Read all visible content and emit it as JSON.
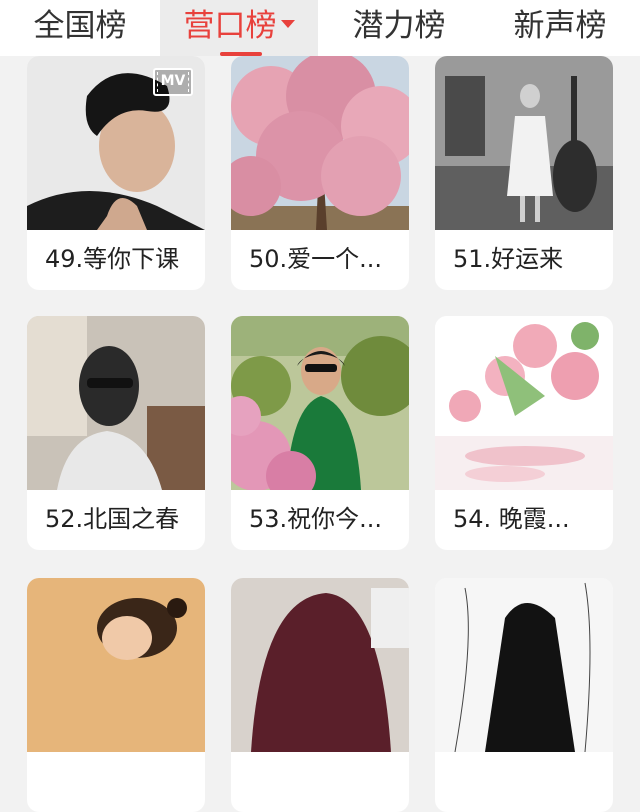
{
  "tabs": [
    {
      "label": "全国榜",
      "active": false
    },
    {
      "label": "营口榜",
      "active": true
    },
    {
      "label": "潜力榜",
      "active": false
    },
    {
      "label": "新声榜",
      "active": false
    }
  ],
  "accent_color": "#e8413c",
  "cards": [
    {
      "title": "49.等你下课",
      "image": "young man profile photo",
      "badge": "MV"
    },
    {
      "title": "50.爱一个...",
      "image": "pink cherry blossom tree"
    },
    {
      "title": "51.好运来",
      "image": "girl with double bass"
    },
    {
      "title": "52.北国之春",
      "image": "man in sunglasses portrait"
    },
    {
      "title": "53.祝你今...",
      "image": "woman among pink flowers"
    },
    {
      "title": "54. 晚霞...",
      "image": "pink roses reflection"
    },
    {
      "title": "",
      "image": "child portrait"
    },
    {
      "title": "",
      "image": "man in dark red shirt"
    },
    {
      "title": "",
      "image": "sketch of person"
    }
  ]
}
